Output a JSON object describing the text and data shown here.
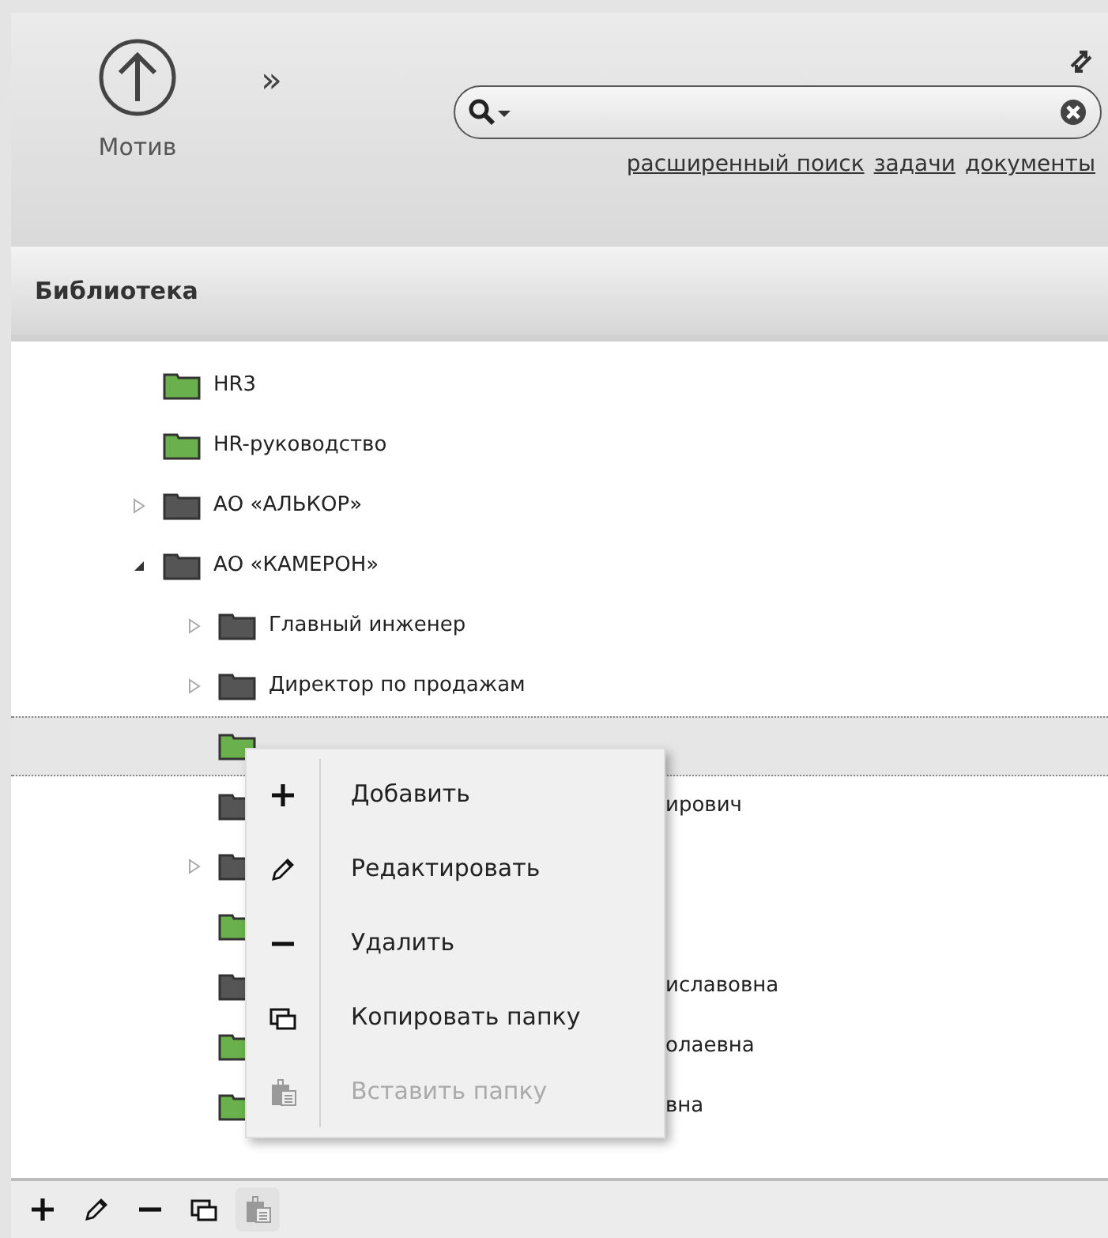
{
  "header": {
    "app_label": "Мотив",
    "expand_glyph": "»",
    "links": [
      "расширенный поиск",
      "задачи",
      "документы"
    ]
  },
  "panel": {
    "title": "Библиотека"
  },
  "tree": [
    {
      "label": "HR3",
      "color": "#6ab04c"
    },
    {
      "label": "HR-руководство",
      "color": "#6ab04c"
    },
    {
      "label": "АО «АЛЬКОР»",
      "color": "#555555",
      "expanded": false
    },
    {
      "label": "АО «КАМЕРОН»",
      "color": "#555555",
      "expanded": true,
      "children": [
        {
          "label": "Главный инженер",
          "color": "#555555",
          "expanded": false,
          "selected": false
        },
        {
          "label": "Директор по продажам",
          "color": "#555555",
          "expanded": false,
          "selected": false
        },
        {
          "color": "#6ab04c",
          "selected": true
        },
        {
          "label_tail": "ирович",
          "color": "#555555",
          "selected": false
        },
        {
          "color": "#555555",
          "expanded": false,
          "selected": false
        },
        {
          "color": "#6ab04c",
          "selected": false
        },
        {
          "label_tail": "иславовна",
          "color": "#555555",
          "selected": false
        },
        {
          "label_tail": "олаевна",
          "color": "#6ab04c",
          "selected": false
        },
        {
          "label_tail": "вна",
          "color": "#6ab04c",
          "selected": false
        }
      ]
    }
  ],
  "context_menu": [
    {
      "kind": "add",
      "label": "Добавить",
      "disabled": false
    },
    {
      "kind": "edit",
      "label": "Редактировать",
      "disabled": false
    },
    {
      "kind": "remove",
      "label": "Удалить",
      "disabled": false
    },
    {
      "kind": "copy",
      "label": "Копировать папку",
      "disabled": false
    },
    {
      "kind": "paste",
      "label": "Вставить папку",
      "disabled": true
    }
  ],
  "toolbar": [
    {
      "kind": "add",
      "disabled": false
    },
    {
      "kind": "edit",
      "disabled": false
    },
    {
      "kind": "remove",
      "disabled": false
    },
    {
      "kind": "copy",
      "disabled": false
    },
    {
      "kind": "paste",
      "disabled": true
    }
  ]
}
